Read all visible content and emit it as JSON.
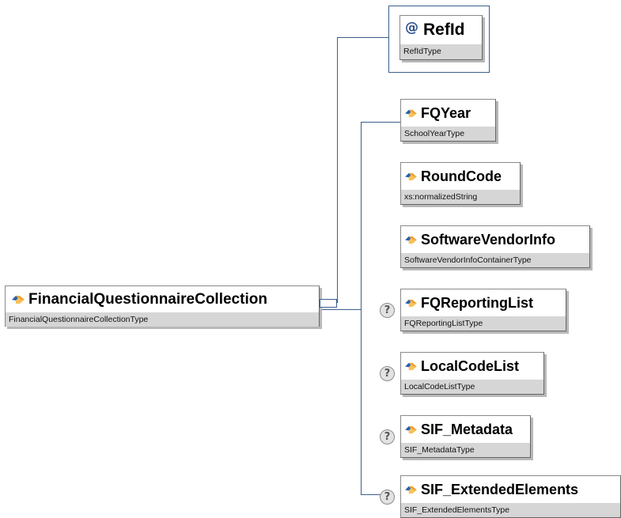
{
  "root": {
    "name": "FinancialQuestionnaireCollection",
    "type": "FinancialQuestionnaireCollectionType"
  },
  "attribute": {
    "symbol": "@",
    "name": "RefId",
    "type": "RefIdType"
  },
  "children": [
    {
      "name": "FQYear",
      "type": "SchoolYearType",
      "optional": false
    },
    {
      "name": "RoundCode",
      "type": "xs:normalizedString",
      "optional": false
    },
    {
      "name": "SoftwareVendorInfo",
      "type": "SoftwareVendorInfoContainerType",
      "optional": false
    },
    {
      "name": "FQReportingList",
      "type": "FQReportingListType",
      "optional": true
    },
    {
      "name": "LocalCodeList",
      "type": "LocalCodeListType",
      "optional": true
    },
    {
      "name": "SIF_Metadata",
      "type": "SIF_MetadataType",
      "optional": true
    },
    {
      "name": "SIF_ExtendedElements",
      "type": "SIF_ExtendedElementsType",
      "optional": true
    }
  ],
  "optional_marker": "?",
  "colors": {
    "connector": "#3a5f8c",
    "type_band": "#d6d6d6",
    "icon_orange": "#f2a02c",
    "icon_blue": "#2b5fa8"
  }
}
